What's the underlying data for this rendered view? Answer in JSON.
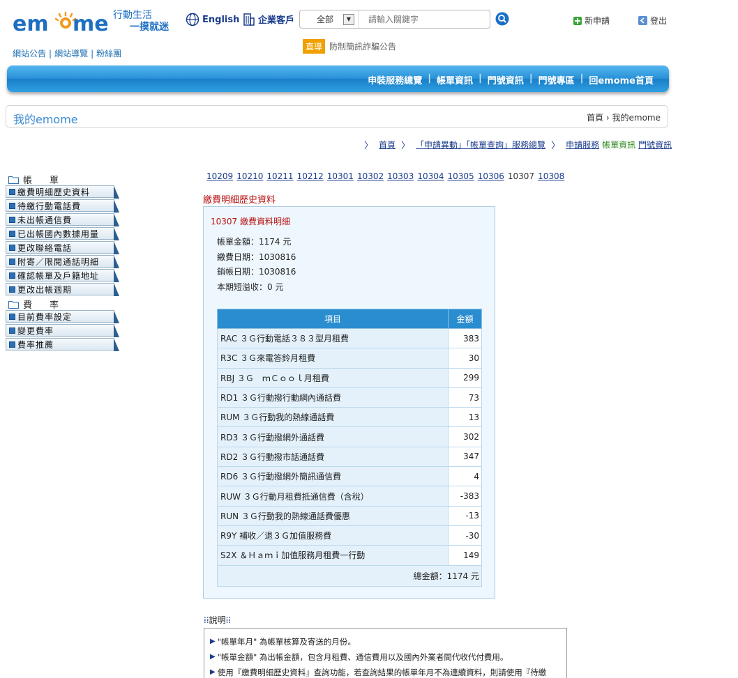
{
  "header": {
    "logo_text": "em me",
    "slogan_line1": "行動生活",
    "slogan_line2": "一摸就迷",
    "english_label": "English",
    "business_label": "企業客戶",
    "search_scope": "全部",
    "search_placeholder": "請輸入關鍵字",
    "new_apply_label": "新申請",
    "logout_label": "登出",
    "sub_links": [
      "網站公告",
      "網站導覽",
      "粉絲團"
    ],
    "notice_tag": "直導",
    "notice_text": "防制簡訊詐騙公告"
  },
  "nav": {
    "items": [
      "申裝服務總覽",
      "帳單資訊",
      "門號資訊",
      "門號專區",
      "回emome首頁"
    ]
  },
  "title_bar": {
    "title": "我的emome",
    "breadcrumb_home": "首頁",
    "breadcrumb_sep": "›",
    "breadcrumb_current": "我的emome"
  },
  "service_links": {
    "home": "首頁",
    "overview": "「申請異動」「帳單查詢」服務總覽",
    "apply": "申請服務",
    "bill_info": "帳單資訊",
    "number_info": "門號資訊"
  },
  "sidebar": {
    "bill_section": "帳　單",
    "bill_items": [
      "繳費明細歷史資料",
      "待繳行動電話費",
      "未出帳通信費",
      "已出帳國內數據用量",
      "更改聯絡電話",
      "附寄／限閱通話明細",
      "確認帳單及戶籍地址",
      "更改出帳週期"
    ],
    "rate_section": "費　率",
    "rate_items": [
      "目前費率設定",
      "變更費率",
      "費率推薦"
    ]
  },
  "main": {
    "months": [
      "10209",
      "10210",
      "10211",
      "10212",
      "10301",
      "10302",
      "10303",
      "10304",
      "10305",
      "10306",
      "10307",
      "10308"
    ],
    "current_month": "10307",
    "section_title": "繳費明細歷史資料",
    "bill_subtitle": "10307 繳費資料明細",
    "bill_amount": "帳單金額：1174 元",
    "pay_date": "繳費日期：1030816",
    "close_date": "銷帳日期：1030816",
    "overpay": "本期短溢收：0 元",
    "table_header_item": "項目",
    "table_header_amount": "金額",
    "rows": [
      {
        "name": "RAC ３Ｇ行動電話３８３型月租費",
        "amount": "383"
      },
      {
        "name": "R3C ３Ｇ來電答鈴月租費",
        "amount": "30"
      },
      {
        "name": "RBJ ３Ｇ　ｍＣｏｏｌ月租費",
        "amount": "299"
      },
      {
        "name": "RD1 ３Ｇ行動撥行動網內通話費",
        "amount": "73"
      },
      {
        "name": "RUM ３Ｇ行動我的熱線通話費",
        "amount": "13"
      },
      {
        "name": "RD3 ３Ｇ行動撥網外通話費",
        "amount": "302"
      },
      {
        "name": "RD2 ３Ｇ行動撥市話通話費",
        "amount": "347"
      },
      {
        "name": "RD6 ３Ｇ行動撥網外簡訊通信費",
        "amount": "4"
      },
      {
        "name": "RUW ３Ｇ行動月租費抵通信費（含稅）",
        "amount": "-383"
      },
      {
        "name": "RUN ３Ｇ行動我的熱線通話費優惠",
        "amount": "-13"
      },
      {
        "name": "R9Y 補收／退３Ｇ加值服務費",
        "amount": "-30"
      },
      {
        "name": "S2X ＆Ｈａｍｉ加值服務月租費一行動",
        "amount": "149"
      }
    ],
    "total": "總金額：1174 元"
  },
  "notes": {
    "heading": "說明",
    "items": [
      "\"帳單年月\" 為帳單核算及寄送的月份。",
      "\"帳單金額\" 為出帳金額，包含月租費、通信費用以及國內外業者間代收代付費用。",
      "使用『繳費明細歷史資料』查詢功能，若查詢結果的帳單年月不為連續資料，則請使用『待繳"
    ]
  },
  "colors": {
    "brand_blue": "#1e6fc2",
    "nav_blue": "#2a93d8",
    "alert_red": "#b81414",
    "notice_orange": "#f0a000"
  }
}
